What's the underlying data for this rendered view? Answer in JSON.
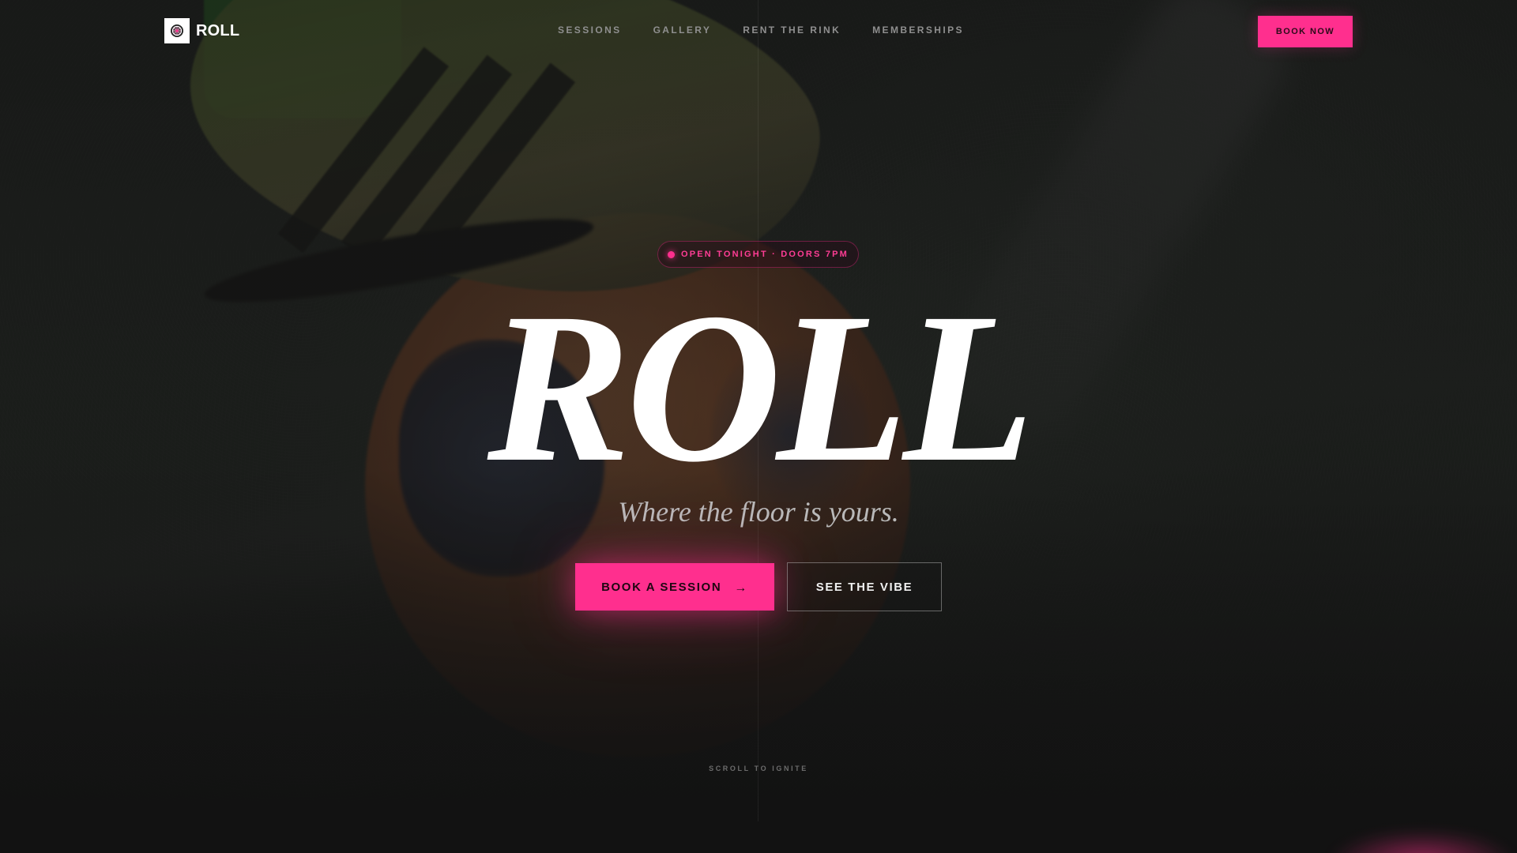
{
  "brand": {
    "name": "ROLL",
    "logo_icon": "disco-ball-icon",
    "accent_color": "#ff2f8e"
  },
  "nav": {
    "items": [
      {
        "label": "SESSIONS"
      },
      {
        "label": "GALLERY"
      },
      {
        "label": "RENT THE RINK"
      },
      {
        "label": "MEMBERSHIPS"
      }
    ]
  },
  "header": {
    "book_now_label": "BOOK NOW"
  },
  "hero": {
    "badge_text": "OPEN TONIGHT · DOORS 7PM",
    "title": "ROLL",
    "tagline": "Where the floor is yours.",
    "primary_cta_label": "BOOK A SESSION",
    "primary_cta_icon": "arrow-right-icon",
    "primary_cta_arrow": "→",
    "secondary_cta_label": "SEE THE VIBE",
    "scroll_hint": "SCROLL TO IGNITE"
  },
  "background": {
    "image_subject": "football-boot-on-ball-photo"
  }
}
